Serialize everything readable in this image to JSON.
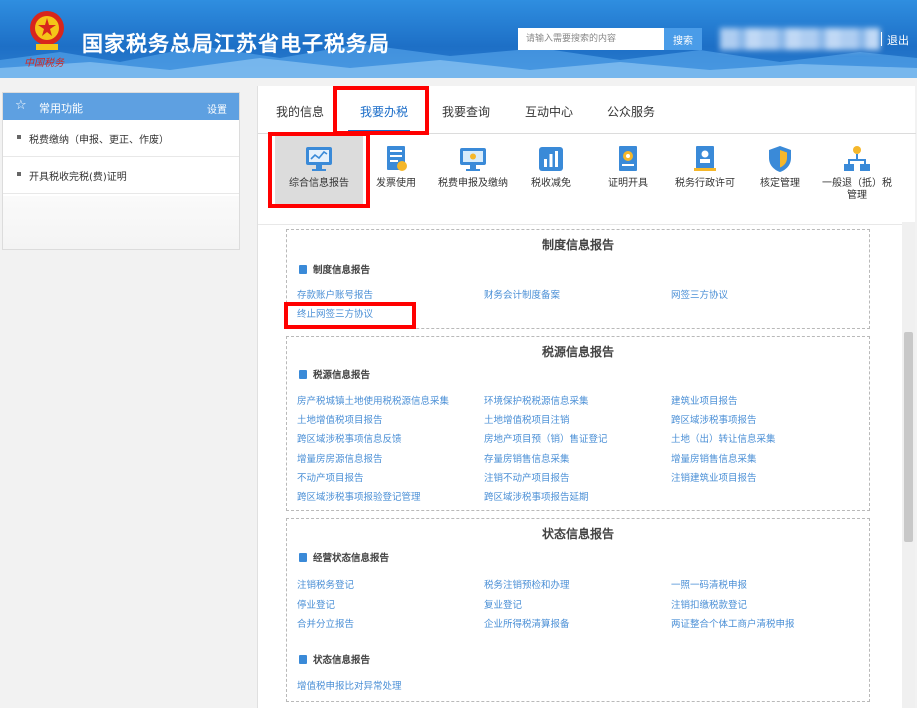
{
  "header": {
    "title": "国家税务总局江苏省电子税务局",
    "calligraphy": "中国税务",
    "search_placeholder": "请输入需要搜索的内容",
    "search_button": "搜索",
    "logout": "退出"
  },
  "sidebar": {
    "title": "常用功能",
    "settings": "设置",
    "items": [
      {
        "label": "税费缴纳（申报、更正、作废）"
      },
      {
        "label": "开具税收完税(费)证明"
      }
    ]
  },
  "tabs": [
    {
      "label": "我的信息"
    },
    {
      "label": "我要办税"
    },
    {
      "label": "我要查询"
    },
    {
      "label": "互动中心"
    },
    {
      "label": "公众服务"
    }
  ],
  "active_tab": "我要办税",
  "functions": [
    {
      "label": "综合信息报告",
      "icon": "monitor-chart-icon"
    },
    {
      "label": "发票使用",
      "icon": "invoice-icon"
    },
    {
      "label": "税费申报及缴纳",
      "icon": "screen-icon"
    },
    {
      "label": "税收减免",
      "icon": "bar-chart-icon"
    },
    {
      "label": "证明开具",
      "icon": "certificate-icon"
    },
    {
      "label": "税务行政许可",
      "icon": "license-icon"
    },
    {
      "label": "核定管理",
      "icon": "shield-icon"
    },
    {
      "label": "一般退（抵）税管理",
      "icon": "hierarchy-icon"
    }
  ],
  "sections": {
    "zhidu": {
      "title": "制度信息报告",
      "sub": "制度信息报告",
      "links": [
        "存款账户账号报告",
        "财务会计制度备案",
        "网签三方协议",
        "终止网签三方协议"
      ]
    },
    "shuiyuan": {
      "title": "税源信息报告",
      "sub": "税源信息报告",
      "links": [
        "房产税城镇土地使用税税源信息采集",
        "环境保护税税源信息采集",
        "建筑业项目报告",
        "土地增值税项目报告",
        "土地增值税项目注销",
        "跨区域涉税事项报告",
        "跨区域涉税事项信息反馈",
        "房地产项目预（销）售证登记",
        "土地（出）转让信息采集",
        "增量房房源信息报告",
        "存量房销售信息采集",
        "增量房销售信息采集",
        "不动产项目报告",
        "注销不动产项目报告",
        "注销建筑业项目报告",
        "跨区域涉税事项报验登记管理",
        "跨区域涉税事项报告延期"
      ]
    },
    "zhuangtai": {
      "title": "状态信息报告",
      "sub1": "经营状态信息报告",
      "links1": [
        "注销税务登记",
        "税务注销预检和办理",
        "一照一码清税申报",
        "停业登记",
        "复业登记",
        "注销扣缴税款登记",
        "合并分立报告",
        "企业所得税清算报备",
        "两证整合个体工商户清税申报"
      ],
      "sub2": "状态信息报告",
      "links2": [
        "增值税申报比对异常处理"
      ]
    }
  },
  "colors": {
    "header_blue": "#1d6fc6",
    "link_blue": "#4a8fd6",
    "highlight_red": "#ff0000",
    "sidebar_head": "#5ea0e1"
  }
}
